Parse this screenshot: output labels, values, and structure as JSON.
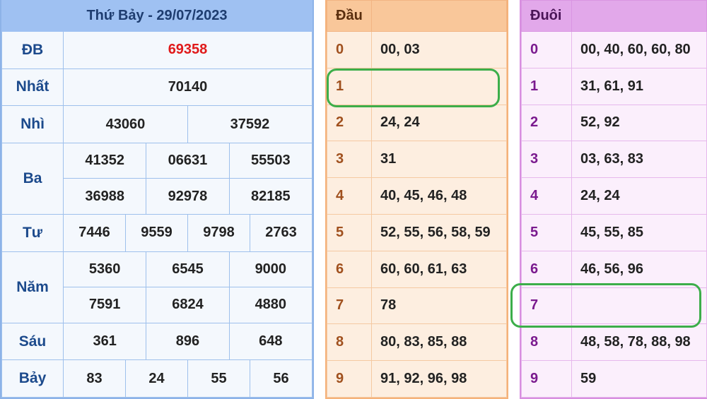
{
  "results": {
    "title": "Thứ Bảy - 29/07/2023",
    "rows": [
      {
        "label": "ĐB",
        "values": [
          "69358"
        ]
      },
      {
        "label": "Nhất",
        "values": [
          "70140"
        ]
      },
      {
        "label": "Nhì",
        "values": [
          "43060",
          "37592"
        ]
      },
      {
        "label": "Ba",
        "values": [
          "41352",
          "06631",
          "55503",
          "36988",
          "92978",
          "82185"
        ]
      },
      {
        "label": "Tư",
        "values": [
          "7446",
          "9559",
          "9798",
          "2763"
        ]
      },
      {
        "label": "Năm",
        "values": [
          "5360",
          "6545",
          "9000",
          "7591",
          "6824",
          "4880"
        ]
      },
      {
        "label": "Sáu",
        "values": [
          "361",
          "896",
          "648"
        ]
      },
      {
        "label": "Bảy",
        "values": [
          "83",
          "24",
          "55",
          "56"
        ]
      }
    ]
  },
  "colors": {
    "special": "#e01a1a",
    "highlight": "#3cae4a"
  },
  "dau": {
    "title": "Đầu",
    "rows": [
      {
        "key": "0",
        "value": "00, 03"
      },
      {
        "key": "1",
        "value": ""
      },
      {
        "key": "2",
        "value": "24, 24"
      },
      {
        "key": "3",
        "value": "31"
      },
      {
        "key": "4",
        "value": "40, 45, 46, 48"
      },
      {
        "key": "5",
        "value": "52, 55, 56, 58, 59"
      },
      {
        "key": "6",
        "value": "60, 60, 61, 63"
      },
      {
        "key": "7",
        "value": "78"
      },
      {
        "key": "8",
        "value": "80, 83, 85, 88"
      },
      {
        "key": "9",
        "value": "91, 92, 96, 98"
      }
    ]
  },
  "duoi": {
    "title": "Đuôi",
    "rows": [
      {
        "key": "0",
        "value": "00, 40, 60, 60, 80"
      },
      {
        "key": "1",
        "value": "31, 61, 91"
      },
      {
        "key": "2",
        "value": "52, 92"
      },
      {
        "key": "3",
        "value": "03, 63, 83"
      },
      {
        "key": "4",
        "value": "24, 24"
      },
      {
        "key": "5",
        "value": "45, 55, 85"
      },
      {
        "key": "6",
        "value": "46, 56, 96"
      },
      {
        "key": "7",
        "value": ""
      },
      {
        "key": "8",
        "value": "48, 58, 78, 88, 98"
      },
      {
        "key": "9",
        "value": "59"
      }
    ]
  }
}
